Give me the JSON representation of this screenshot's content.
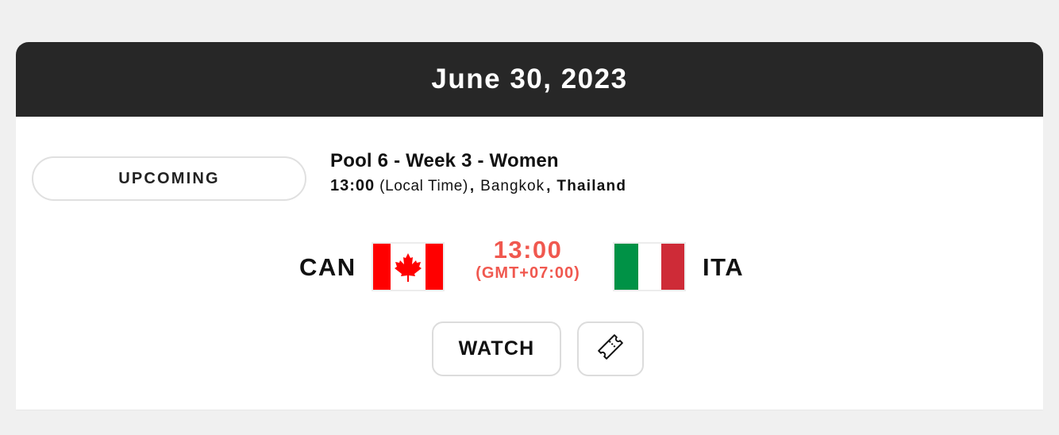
{
  "header": {
    "date": "June 30, 2023"
  },
  "match": {
    "status": "UPCOMING",
    "title": "Pool 6 - Week 3 - Women",
    "local_time": "13:00",
    "local_time_label": "(Local Time)",
    "separator": ",",
    "city": "Bangkok",
    "country": "Thailand",
    "home": {
      "code": "CAN",
      "flag_icon": "canada-flag-icon",
      "flag_colors": [
        "#ff0000",
        "#ffffff",
        "#ff0000"
      ]
    },
    "away": {
      "code": "ITA",
      "flag_icon": "italy-flag-icon",
      "flag_colors": [
        "#009246",
        "#ffffff",
        "#ce2b37"
      ]
    },
    "kickoff_time": "13:00",
    "kickoff_timezone": "(GMT+07:00)"
  },
  "actions": {
    "watch_label": "WATCH",
    "ticket_icon": "ticket-icon"
  },
  "colors": {
    "header_bg": "#272727",
    "accent": "#f0584f"
  }
}
